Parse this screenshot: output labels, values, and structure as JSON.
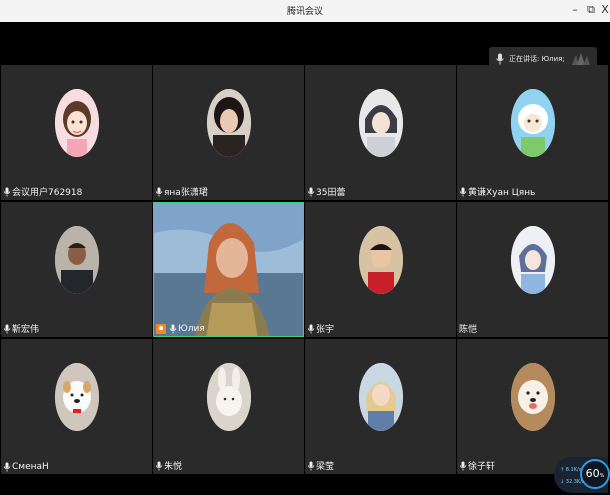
{
  "window": {
    "title": "腾讯会议",
    "minimize_glyph": "–",
    "maximize_glyph": "⧉",
    "close_glyph": "X"
  },
  "speaking": {
    "text": "正在讲话: Юлия;"
  },
  "colors": {
    "active_border": "#3bd27a",
    "host_badge": "#f08a24",
    "tile_bg": "#2a2a2a"
  },
  "participants": [
    {
      "name": "会议用户762918",
      "avatar": "cartoon-girl-avatar",
      "mic": true
    },
    {
      "name": "яна张潇珺",
      "avatar": "woman-photo-avatar",
      "mic": true
    },
    {
      "name": "35田蕾",
      "avatar": "anime-boy-avatar",
      "mic": true
    },
    {
      "name": "黄谦Хуан Цянь",
      "avatar": "sheep-cartoon-avatar",
      "mic": true
    },
    {
      "name": "靳宏伟",
      "avatar": "man-photo-avatar",
      "mic": true
    },
    {
      "name": "Юлия",
      "avatar": "video-feed",
      "mic": true,
      "host": true,
      "active": true
    },
    {
      "name": "张宇",
      "avatar": "boy-photo-avatar",
      "mic": true
    },
    {
      "name": "陈恺",
      "avatar": "anime-character-avatar",
      "mic": false
    },
    {
      "name": "СменаН",
      "avatar": "dog-plush-avatar",
      "mic": true
    },
    {
      "name": "朱悦",
      "avatar": "bunny-plush-avatar",
      "mic": true
    },
    {
      "name": "梁莹",
      "avatar": "girl-photo-avatar",
      "mic": true
    },
    {
      "name": "徐子轩",
      "avatar": "samoyed-dog-avatar",
      "mic": true
    }
  ],
  "network": {
    "upload": "↑ 8.1K/s",
    "download": "↓ 32.3K/s",
    "percent": "60",
    "percent_unit": "%"
  }
}
